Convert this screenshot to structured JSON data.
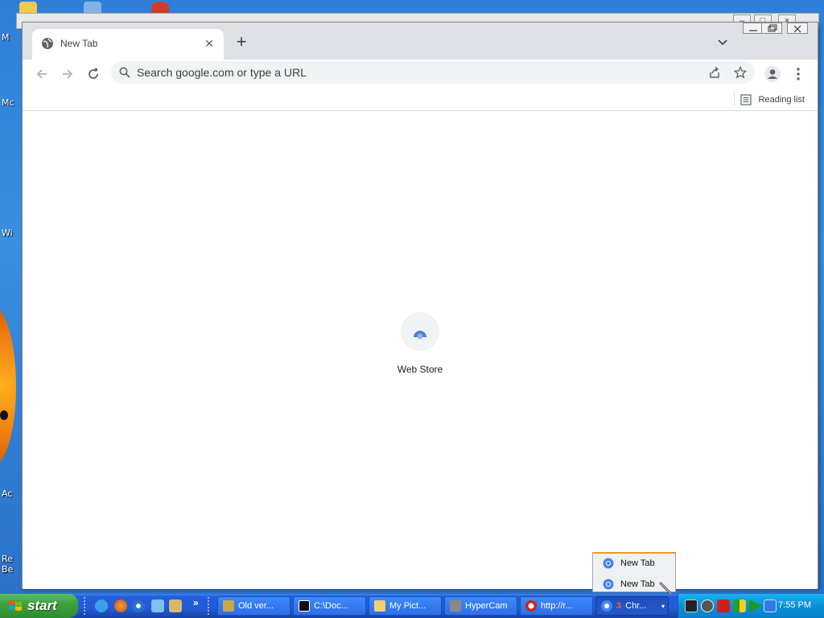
{
  "desktop": {
    "labels": [
      "M",
      "Mc",
      "Wi",
      "Ac",
      "Re",
      "Be"
    ]
  },
  "browser": {
    "tab": {
      "title": "New Tab"
    },
    "omnibox": {
      "placeholder": "Search google.com or type a URL"
    },
    "bookmarks_bar": {
      "reading_list_label": "Reading list"
    },
    "shortcuts": [
      {
        "label": "Web Store"
      }
    ]
  },
  "jump_list": {
    "items": [
      {
        "label": "New Tab"
      },
      {
        "label": "New Tab"
      }
    ]
  },
  "taskbar": {
    "start_label": "start",
    "quick_launch_more": "»",
    "buttons": [
      {
        "label": "Old ver..."
      },
      {
        "label": "C:\\Doc..."
      },
      {
        "label": "My Pict..."
      },
      {
        "label": "HyperCam"
      },
      {
        "label": "http://r..."
      },
      {
        "label": "Chr...",
        "count": "3"
      }
    ],
    "clock": "7:55 PM"
  },
  "colors": {
    "tabstrip": "#dee1e6",
    "omnibox": "#f1f3f4",
    "taskbar_blue": "#245edb",
    "start_green": "#3ea23e",
    "tray_blue": "#0d8ed8"
  }
}
